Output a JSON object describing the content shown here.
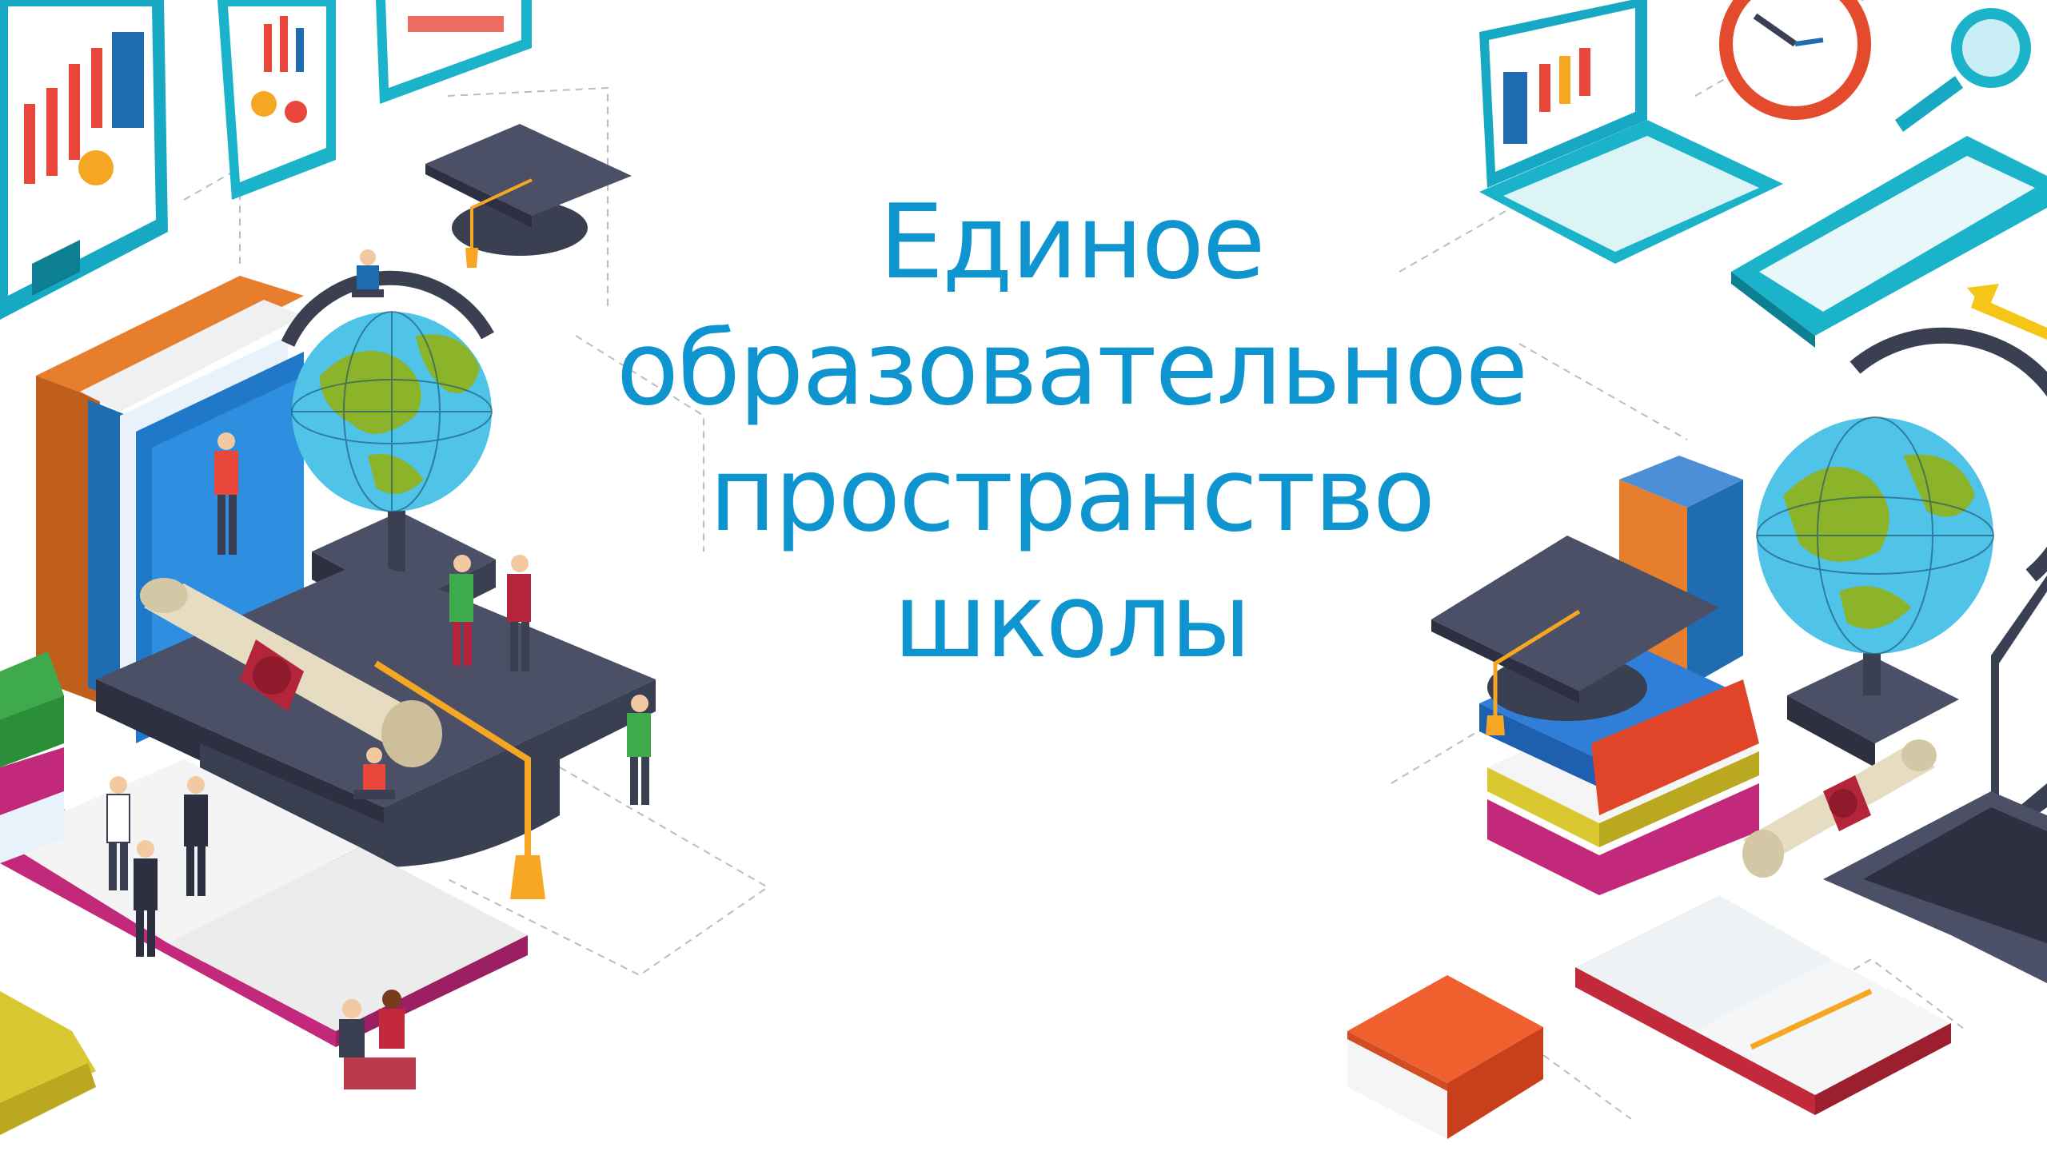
{
  "slide": {
    "title_lines": [
      "Единое",
      "образовательное",
      "пространство",
      "школы"
    ]
  },
  "illustration": {
    "left_group": [
      "monitor-chart",
      "tablet-chart",
      "graduation-cap",
      "globe",
      "book-stack",
      "diploma-scroll",
      "open-book",
      "people"
    ],
    "right_group": [
      "laptop",
      "clock",
      "magnifier",
      "keyboard",
      "globe",
      "book-stack",
      "graduation-cap",
      "diploma-scroll",
      "laptop",
      "open-book",
      "red-book"
    ]
  },
  "colors": {
    "title": "#0e95cf",
    "teal": "#1bb3c9",
    "dark_cap": "#3a3f52",
    "orange": "#f5a623",
    "globe_sea": "#4fc3e8",
    "globe_land": "#8cb42a",
    "red": "#e0452a",
    "magenta": "#c2297a"
  }
}
